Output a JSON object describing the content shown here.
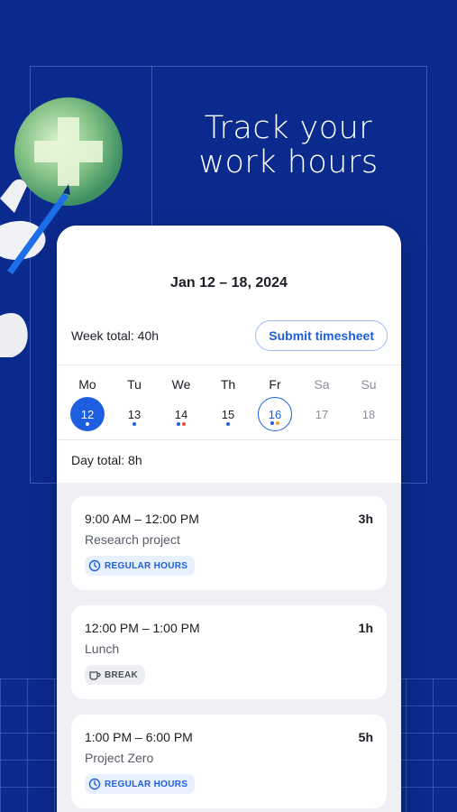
{
  "headline": "Track your work hours",
  "header": {
    "date_range": "Jan 12 – 18, 2024"
  },
  "summary": {
    "week_total": "Week total: 40h",
    "submit_label": "Submit timesheet"
  },
  "week": [
    {
      "name": "Mo",
      "num": "12",
      "state": "selected",
      "dots": [
        "#ffffff"
      ]
    },
    {
      "name": "Tu",
      "num": "13",
      "state": "normal",
      "dots": [
        "#1d5fe0"
      ]
    },
    {
      "name": "We",
      "num": "14",
      "state": "normal",
      "dots": [
        "#1d5fe0",
        "#e5532d"
      ]
    },
    {
      "name": "Th",
      "num": "15",
      "state": "normal",
      "dots": [
        "#1d5fe0"
      ]
    },
    {
      "name": "Fr",
      "num": "16",
      "state": "today",
      "dots": [
        "#1d5fe0",
        "#f0a030"
      ]
    },
    {
      "name": "Sa",
      "num": "17",
      "state": "muted",
      "dots": []
    },
    {
      "name": "Su",
      "num": "18",
      "state": "muted",
      "dots": []
    }
  ],
  "day_total": "Day total: 8h",
  "entries": [
    {
      "time": "9:00 AM – 12:00 PM",
      "duration": "3h",
      "project": "Research project",
      "tag": "REGULAR HOURS",
      "tag_type": "regular",
      "icon": "clock-icon"
    },
    {
      "time": "12:00 PM – 1:00 PM",
      "duration": "1h",
      "project": "Lunch",
      "tag": "BREAK",
      "tag_type": "break",
      "icon": "coffee-cup-icon"
    },
    {
      "time": "1:00 PM – 6:00 PM",
      "duration": "5h",
      "project": "Project Zero",
      "tag": "REGULAR HOURS",
      "tag_type": "regular",
      "icon": "clock-icon"
    }
  ],
  "colors": {
    "background": "#0a2a8e",
    "accent": "#1d5fe0"
  }
}
